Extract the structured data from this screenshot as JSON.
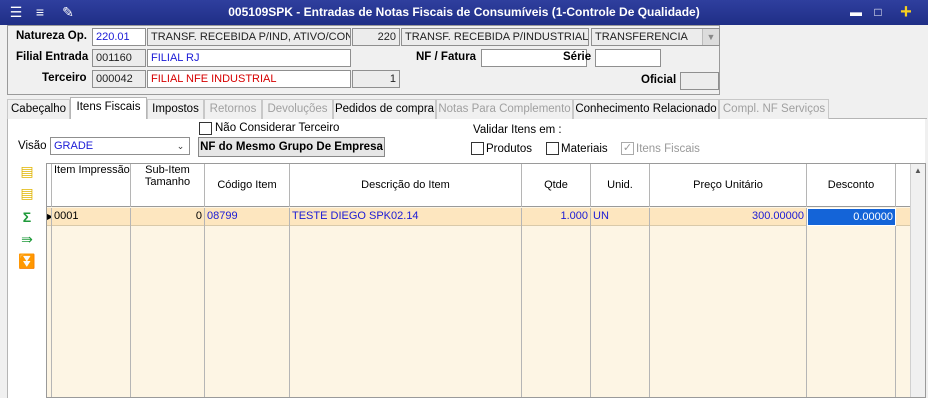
{
  "window": {
    "title": "005109SPK - Entradas de Notas Fiscais de Consumíveis (1-Controle De Qualidade)"
  },
  "header": {
    "natureza_label": "Natureza Op.",
    "natureza_code": "220.01",
    "natureza_desc": "TRANSF. RECEBIDA P/IND, ATIVO/CONSI",
    "natureza_num": "220",
    "natureza_desc2": "TRANSF. RECEBIDA P/INDUSTRIALIZA",
    "tipo_value": "TRANSFERENCIA",
    "filial_label": "Filial Entrada",
    "filial_code": "001160",
    "filial_desc": "FILIAL RJ",
    "nf_label": "NF / Fatura",
    "nf_value": "",
    "serie_label": "Série",
    "serie_value": "",
    "terceiro_label": "Terceiro",
    "terceiro_code": "000042",
    "terceiro_desc": "FILIAL NFE INDUSTRIAL",
    "terceiro_num": "1",
    "oficial_label": "Oficial",
    "oficial_value": ""
  },
  "tabs": [
    {
      "label": "Cabeçalho",
      "state": "normal"
    },
    {
      "label": "Itens Fiscais",
      "state": "active"
    },
    {
      "label": "Impostos",
      "state": "normal"
    },
    {
      "label": "Retornos",
      "state": "disabled"
    },
    {
      "label": "Devoluções",
      "state": "disabled"
    },
    {
      "label": "Pedidos de compra",
      "state": "normal"
    },
    {
      "label": "Notas Para Complemento",
      "state": "disabled"
    },
    {
      "label": "Conhecimento Relacionado",
      "state": "normal"
    },
    {
      "label": "Compl. NF Serviços",
      "state": "disabled"
    }
  ],
  "itens": {
    "visao_label": "Visão",
    "visao_value": "GRADE",
    "nao_considerar_label": "Não Considerar Terceiro",
    "nf_grupo_button": "NF do Mesmo Grupo De Empresa",
    "validar_label": "Validar Itens em :",
    "produtos_label": "Produtos",
    "materiais_label": "Materiais",
    "itens_fiscais_label": "Itens Fiscais"
  },
  "grid": {
    "columns": [
      "Item Impressão",
      "Sub-Item Tamanho",
      "Código Item",
      "Descrição do Item",
      "Qtde",
      "Unid.",
      "Preço Unitário",
      "Desconto"
    ],
    "rows": [
      {
        "item": "0001",
        "subitem": "0",
        "codigo": "08799",
        "descricao": "TESTE DIEGO SPK02.14",
        "qtde": "1.000",
        "unid": "UN",
        "preco": "300.00000",
        "desconto": "0.00000"
      }
    ]
  },
  "icons": [
    "menu-icon",
    "traffic-light-icon",
    "wrench-icon",
    "minimize-icon",
    "maximize-icon",
    "add-icon",
    "add-row-icon",
    "remove-row-icon",
    "sum-icon",
    "export-icon",
    "collapse-icon"
  ],
  "colors": {
    "titlebar": "#1f2e86",
    "accent_blue": "#1a1ad6",
    "red_text": "#d60000",
    "selected_row": "#fde6bf",
    "grid_bg": "#fdf5e4"
  }
}
